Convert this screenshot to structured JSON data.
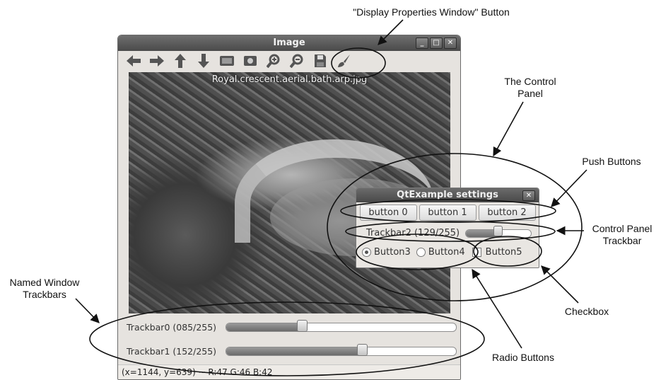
{
  "annotations": {
    "display_props": "\"Display Properties Window\" Button",
    "control_panel": [
      "The Control",
      "Panel"
    ],
    "push_buttons": "Push Buttons",
    "cp_trackbar": [
      "Control Panel",
      "Trackbar"
    ],
    "named_window": [
      "Named Window",
      "Trackbars"
    ],
    "checkbox": "Checkbox",
    "radio_buttons": "Radio Buttons"
  },
  "image_window": {
    "title": "Image",
    "window_buttons": [
      "_",
      "□",
      "✕"
    ],
    "toolbar_icons": [
      "arrow-left-icon",
      "arrow-right-icon",
      "arrow-up-icon",
      "arrow-down-icon",
      "zoom-fit-icon",
      "zoom-region-icon",
      "zoom-in-icon",
      "zoom-out-icon",
      "save-icon",
      "display-properties-icon"
    ],
    "image_name": "Royal.crescent.aerial.bath.arp.jpg",
    "trackbars": [
      {
        "label": "Trackbar0 (085/255)",
        "value": 85,
        "max": 255
      },
      {
        "label": "Trackbar1 (152/255)",
        "value": 152,
        "max": 255
      }
    ],
    "status": "(x=1144, y=639) ~ R:47 G:46 B:42"
  },
  "control_panel": {
    "title": "QtExample settings",
    "close": "✕",
    "push_buttons": [
      "button 0",
      "button 1",
      "button 2"
    ],
    "trackbar": {
      "label": "Trackbar2 (129/255)",
      "value": 129,
      "max": 255
    },
    "radios": [
      {
        "label": "Button3",
        "checked": true
      },
      {
        "label": "Button4",
        "checked": false
      }
    ],
    "checkbox": {
      "label": "Button5",
      "checked": false
    }
  }
}
